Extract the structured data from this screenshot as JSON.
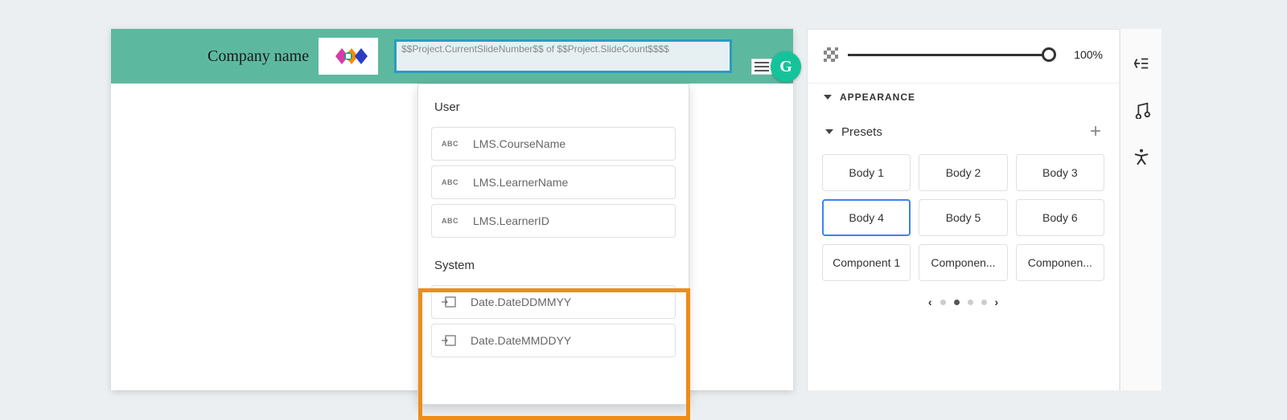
{
  "header": {
    "company_label": "Company name",
    "variable_text": "$$Project.CurrentSlideNumber$$ of $$Project.SlideCount$$$$"
  },
  "dropdown": {
    "sections": {
      "user": {
        "label": "User",
        "items": [
          "LMS.CourseName",
          "LMS.LearnerName",
          "LMS.LearnerID"
        ]
      },
      "system": {
        "label": "System",
        "items": [
          "Date.DateDDMMYY",
          "Date.DateMMDDYY"
        ]
      }
    },
    "abc_icon": "ABC"
  },
  "inspector": {
    "opacity": {
      "value_label": "100%"
    },
    "appearance_label": "APPEARANCE",
    "presets_label": "Presets",
    "presets": [
      "Body 1",
      "Body 2",
      "Body 3",
      "Body 4",
      "Body 5",
      "Body 6",
      "Component 1",
      "Componen...",
      "Componen..."
    ],
    "selected_preset_index": 3,
    "pager": {
      "active_index": 1,
      "dot_count": 4
    }
  },
  "grammarly": {
    "letter": "G"
  }
}
